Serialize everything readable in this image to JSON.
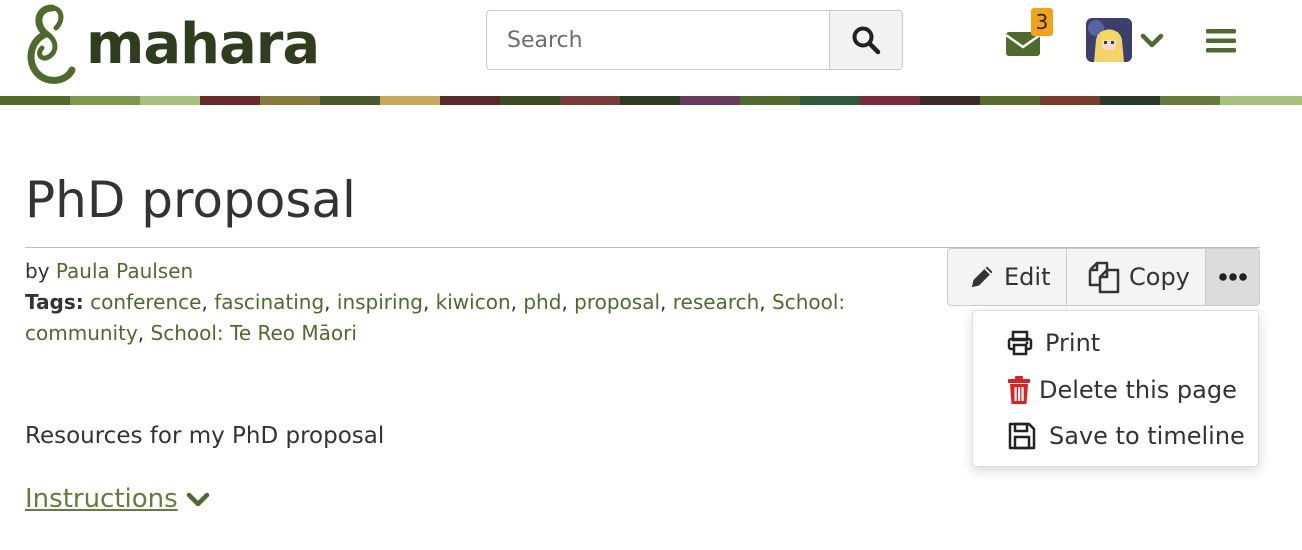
{
  "header": {
    "logo_text": "mahara",
    "search": {
      "placeholder": "Search",
      "value": ""
    },
    "mail_badge_count": "3",
    "icons": {
      "logo": "mahara-koru-icon",
      "search": "search-icon",
      "mail": "envelope-icon",
      "avatar": "user-avatar",
      "user_menu": "chevron-down-icon",
      "main_menu": "hamburger-icon"
    }
  },
  "page": {
    "title": "PhD proposal",
    "by_label": "by",
    "author": "Paula Paulsen",
    "tags_label": "Tags:",
    "tags": [
      "conference",
      "fascinating",
      "inspiring",
      "kiwicon",
      "phd",
      "proposal",
      "research",
      "School: community",
      "School: Te Reo Māori"
    ],
    "description": "Resources for my PhD proposal",
    "instructions_label": "Instructions"
  },
  "toolbar": {
    "edit_label": "Edit",
    "copy_label": "Copy",
    "more_icon": "ellipsis-icon"
  },
  "more_menu": {
    "items": [
      {
        "label": "Print",
        "icon": "print-icon"
      },
      {
        "label": "Delete this page",
        "icon": "trash-icon"
      },
      {
        "label": "Save to timeline",
        "icon": "floppy-icon"
      }
    ]
  },
  "colors": {
    "brand_dark": "#2f3d1f",
    "brand_green": "#4e6b2b",
    "link_green": "#5f7f3a",
    "badge_orange": "#f3a21a",
    "danger_red": "#e02020"
  }
}
